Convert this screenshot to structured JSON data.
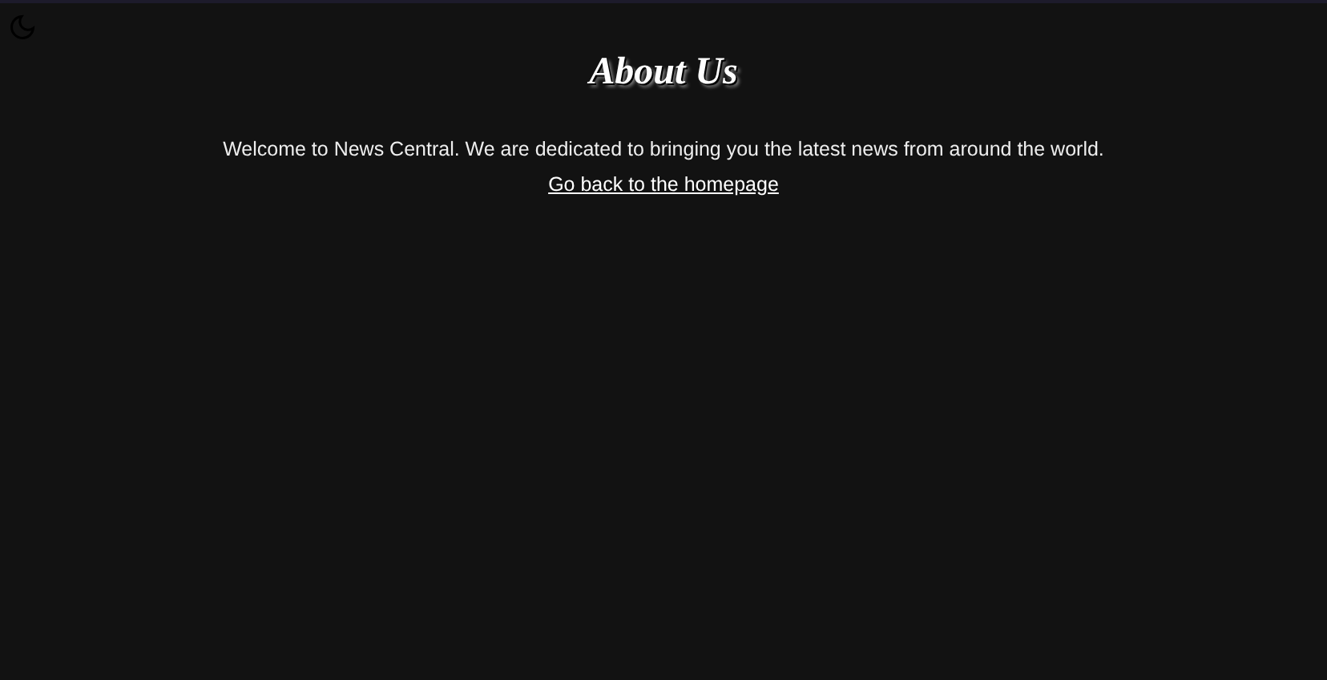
{
  "theme_toggle": {
    "on": true
  },
  "heading": "About Us",
  "intro": "Welcome to News Central. We are dedicated to bringing you the latest news from around the world.",
  "home_link": "Go back to the homepage"
}
